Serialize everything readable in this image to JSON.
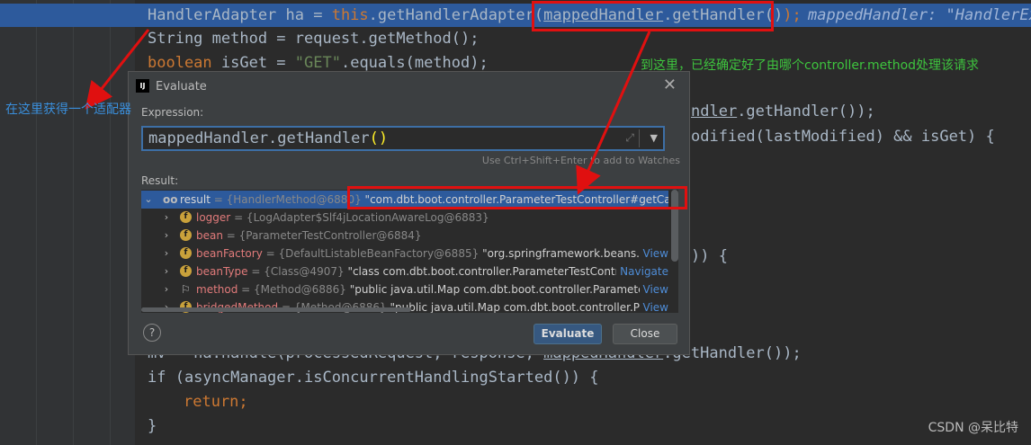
{
  "editor": {
    "line1": {
      "prefix": "HandlerAdapter ha = ",
      "kw_this": "this",
      "call": ".getHandlerAdapter(",
      "arg_var": "mappedHandler",
      "arg_call": ".getHandler()",
      "suffix": ");",
      "inline_hint": "mappedHandler: \"HandlerEx"
    },
    "line2": "String method = request.getMethod();",
    "line3": {
      "kw": "boolean",
      "mid": " isGet = ",
      "str": "\"GET\"",
      "rest": ".equals(method);"
    },
    "behind_a": {
      "var_tail": "ndler",
      "rest": ".getHandler());"
    },
    "behind_b": "odified(lastModified) && isGet) {",
    "behind_c": ")) {",
    "line_mv": {
      "start": "mv = ha.handle(processedRequest, response, ",
      "var": "mappedHandler",
      "end": ".getHandler());"
    },
    "line_if": "if (asyncManager.isConcurrentHandlingStarted()) {",
    "line_return": {
      "kw": "return",
      "end": ";"
    },
    "line_brace": "}"
  },
  "annotations": {
    "left_note": "在这里获得一个适配器",
    "right_note": "到这里，已经确定好了由哪个controller.method处理该请求",
    "left_color": "#3a8fdc",
    "right_color": "#3ec43e",
    "box_color": "#e01010"
  },
  "dialog": {
    "title": "Evaluate",
    "app_icon": "IJ",
    "close_glyph": "✕",
    "expression_label": "Expression:",
    "expression": {
      "text": "mappedHandler.getHandler",
      "parens": "()"
    },
    "hint": "Use Ctrl+Shift+Enter to add to Watches",
    "result_label": "Result:",
    "tree": [
      {
        "name": "result",
        "meta": "= {HandlerMethod@6880}",
        "value": "\"com.dbt.boot.controller.ParameterTestController#getCar(Inte",
        "link": ""
      },
      {
        "name": "logger",
        "meta": "= {LogAdapter$Slf4jLocationAwareLog@6883}",
        "value": "",
        "link": ""
      },
      {
        "name": "bean",
        "meta": "= {ParameterTestController@6884}",
        "value": "",
        "link": ""
      },
      {
        "name": "beanFactory",
        "meta": "= {DefaultListableBeanFactory@6885}",
        "value": "\"org.springframework.beans.facto",
        "link": "View"
      },
      {
        "name": "beanType",
        "meta": "= {Class@4907}",
        "value": "\"class com.dbt.boot.controller.ParameterTestControlle...",
        "link": "Navigate"
      },
      {
        "name": "method",
        "meta": "= {Method@6886}",
        "value": "\"public java.util.Map com.dbt.boot.controller.ParameterTe...",
        "link": "View"
      },
      {
        "name": "bridgedMethod",
        "meta": "= {Method@6886}",
        "value": "\"public java.util.Map com.dbt.boot.controller.Para...",
        "link": "View"
      }
    ],
    "help_label": "?",
    "evaluate_label": "Evaluate",
    "close_label": "Close"
  },
  "watermark": "CSDN @呆比特",
  "icons": {
    "glasses": "oo",
    "field": "f",
    "method_flag": "⚐",
    "chevron_down": "⌄",
    "chevron_right": "›",
    "dropdown": "▼",
    "expand": "⤢"
  }
}
